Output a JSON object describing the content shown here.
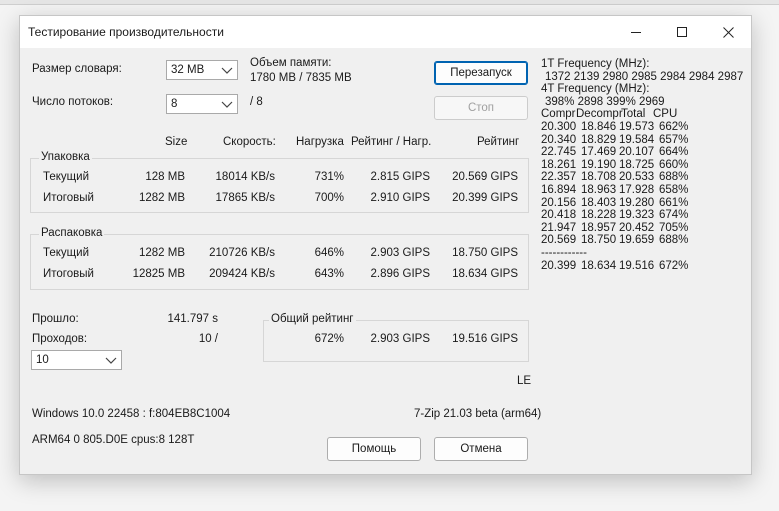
{
  "window": {
    "title": "Тестирование производительности"
  },
  "settings": {
    "dict_size_label": "Размер словаря:",
    "dict_size_value": "32 MB",
    "threads_label": "Число потоков:",
    "threads_value": "8",
    "threads_max": "/ 8",
    "memory_label": "Объем памяти:",
    "memory_value": "1780 MB / 7835 MB"
  },
  "buttons": {
    "restart": "Перезапуск",
    "stop": "Стоп",
    "help": "Помощь",
    "cancel": "Отмена"
  },
  "table_headers": {
    "size": "Size",
    "speed": "Скорость:",
    "load": "Нагрузка",
    "rating_load": "Рейтинг / Нагр.",
    "rating": "Рейтинг"
  },
  "packing": {
    "label": "Упаковка",
    "rows": [
      {
        "name": "Текущий",
        "size": "128 MB",
        "speed": "18014 KB/s",
        "load": "731%",
        "rating_load": "2.815 GIPS",
        "rating": "20.569 GIPS"
      },
      {
        "name": "Итоговый",
        "size": "1282 MB",
        "speed": "17865 KB/s",
        "load": "700%",
        "rating_load": "2.910 GIPS",
        "rating": "20.399 GIPS"
      }
    ]
  },
  "unpacking": {
    "label": "Распаковка",
    "rows": [
      {
        "name": "Текущий",
        "size": "1282 MB",
        "speed": "210726 KB/s",
        "load": "646%",
        "rating_load": "2.903 GIPS",
        "rating": "18.750 GIPS"
      },
      {
        "name": "Итоговый",
        "size": "12825 MB",
        "speed": "209424 KB/s",
        "load": "643%",
        "rating_load": "2.896 GIPS",
        "rating": "18.634 GIPS"
      }
    ]
  },
  "elapsed": {
    "label": "Прошло:",
    "value": "141.797 s"
  },
  "passes": {
    "label": "Проходов:",
    "value": "10 /",
    "select_value": "10"
  },
  "overall": {
    "label": "Общий рейтинг",
    "load": "672%",
    "rating_load": "2.903 GIPS",
    "rating": "19.516 GIPS"
  },
  "endianness": "LE",
  "system": {
    "os": "Windows 10.0 22458 : f:804EB8C1004",
    "cpu": "ARM64 0 805.D0E cpus:8 128T",
    "version": "7-Zip 21.03 beta (arm64)"
  },
  "freq_panel": {
    "freq1_label": "1T Frequency (MHz):",
    "freq1_values": "1372 2139 2980 2985 2984 2984 2987",
    "freq4_label": "4T Frequency (MHz):",
    "freq4_values": "398% 2898 399% 2969",
    "header": [
      "Compr",
      "Decompr",
      "Total",
      "CPU"
    ],
    "rows": [
      [
        "20.300",
        "18.846",
        "19.573",
        "662%"
      ],
      [
        "20.340",
        "18.829",
        "19.584",
        "657%"
      ],
      [
        "22.745",
        "17.469",
        "20.107",
        "664%"
      ],
      [
        "18.261",
        "19.190",
        "18.725",
        "660%"
      ],
      [
        "22.357",
        "18.708",
        "20.533",
        "688%"
      ],
      [
        "16.894",
        "18.963",
        "17.928",
        "658%"
      ],
      [
        "20.156",
        "18.403",
        "19.280",
        "661%"
      ],
      [
        "20.418",
        "18.228",
        "19.323",
        "674%"
      ],
      [
        "21.947",
        "18.957",
        "20.452",
        "705%"
      ],
      [
        "20.569",
        "18.750",
        "19.659",
        "688%"
      ]
    ],
    "separator": "------------",
    "total": [
      "20.399",
      "18.634",
      "19.516",
      "672%"
    ]
  }
}
